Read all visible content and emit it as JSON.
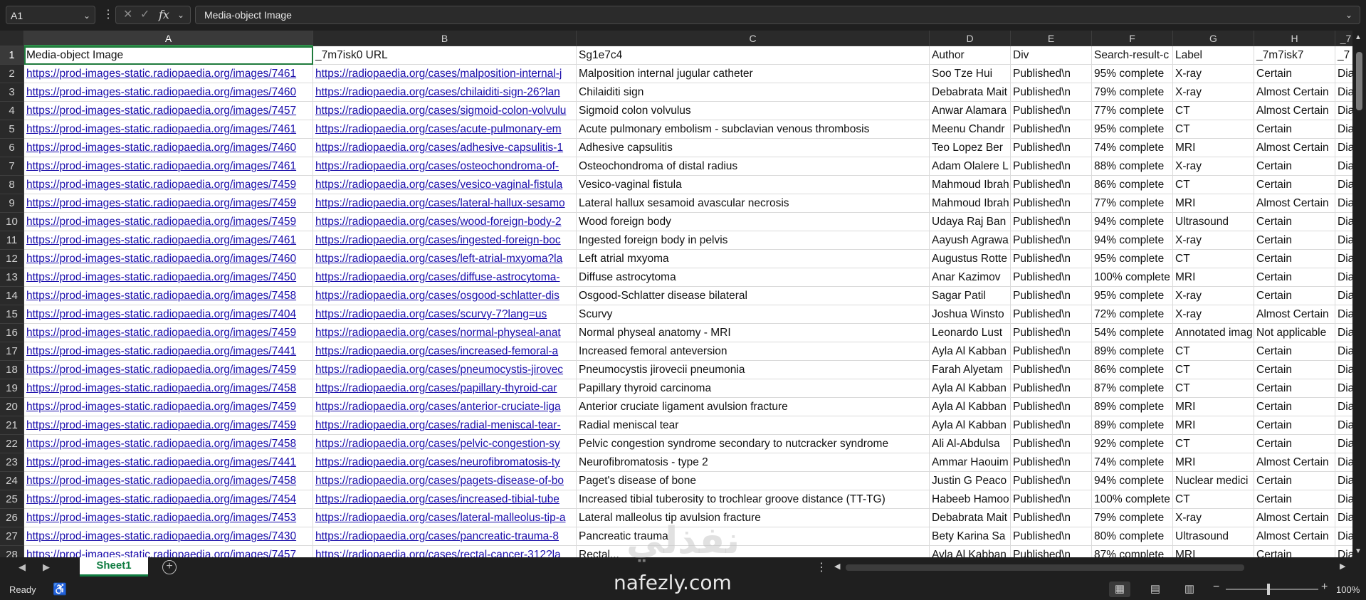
{
  "formula_bar": {
    "name_box": "A1",
    "fx_label": "fx",
    "formula_value": "Media-object Image"
  },
  "columns": [
    "A",
    "B",
    "C",
    "D",
    "E",
    "F",
    "G",
    "H",
    "I"
  ],
  "column_partial_label": "_7",
  "row_numbers": [
    "1",
    "2",
    "3",
    "4",
    "5",
    "6",
    "7",
    "8",
    "9",
    "10",
    "11",
    "12",
    "13",
    "14",
    "15",
    "16",
    "17",
    "18",
    "19",
    "20",
    "21",
    "22",
    "23",
    "24",
    "25",
    "26",
    "27",
    "28"
  ],
  "rows": [
    [
      "Media-object Image",
      "_7m7isk0 URL",
      "Sg1e7c4",
      "Author",
      "Div",
      "Search-result-c",
      "Label",
      "_7m7isk7",
      "_7"
    ],
    [
      "https://prod-images-static.radiopaedia.org/images/7461",
      "https://radiopaedia.org/cases/malposition-internal-j",
      "Malposition internal jugular catheter",
      "Soo Tze Hui",
      "Published\\n",
      "95% complete",
      "X-ray",
      "Certain",
      "Dia"
    ],
    [
      "https://prod-images-static.radiopaedia.org/images/7460",
      "https://radiopaedia.org/cases/chilaiditi-sign-26?lan",
      "Chilaiditi sign",
      "Debabrata Mait",
      "Published\\n",
      "79% complete",
      "X-ray",
      "Almost Certain",
      "Dia"
    ],
    [
      "https://prod-images-static.radiopaedia.org/images/7457",
      "https://radiopaedia.org/cases/sigmoid-colon-volvulu",
      "Sigmoid colon volvulus",
      "Anwar Alamara",
      "Published\\n",
      "77% complete",
      "CT",
      "Almost Certain",
      "Dia"
    ],
    [
      "https://prod-images-static.radiopaedia.org/images/7461",
      "https://radiopaedia.org/cases/acute-pulmonary-em",
      "Acute pulmonary embolism - subclavian venous thrombosis",
      "Meenu Chandr",
      "Published\\n",
      "95% complete",
      "CT",
      "Certain",
      "Dia"
    ],
    [
      "https://prod-images-static.radiopaedia.org/images/7460",
      "https://radiopaedia.org/cases/adhesive-capsulitis-1",
      "Adhesive capsulitis",
      "Teo Lopez Ber",
      "Published\\n",
      "74% complete",
      "MRI",
      "Almost Certain",
      "Dia"
    ],
    [
      "https://prod-images-static.radiopaedia.org/images/7461",
      "https://radiopaedia.org/cases/osteochondroma-of-",
      "Osteochondroma of distal radius",
      "Adam Olalere L",
      "Published\\n",
      "88% complete",
      "X-ray",
      "Certain",
      "Dia"
    ],
    [
      "https://prod-images-static.radiopaedia.org/images/7459",
      "https://radiopaedia.org/cases/vesico-vaginal-fistula",
      "Vesico-vaginal fistula",
      "Mahmoud Ibrah",
      "Published\\n",
      "86% complete",
      "CT",
      "Certain",
      "Dia"
    ],
    [
      "https://prod-images-static.radiopaedia.org/images/7459",
      "https://radiopaedia.org/cases/lateral-hallux-sesamo",
      "Lateral hallux sesamoid avascular necrosis",
      "Mahmoud Ibrah",
      "Published\\n",
      "77% complete",
      "MRI",
      "Almost Certain",
      "Dia"
    ],
    [
      "https://prod-images-static.radiopaedia.org/images/7459",
      "https://radiopaedia.org/cases/wood-foreign-body-2",
      "Wood foreign body",
      "Udaya Raj Ban",
      "Published\\n",
      "94% complete",
      "Ultrasound",
      "Certain",
      "Dia"
    ],
    [
      "https://prod-images-static.radiopaedia.org/images/7461",
      "https://radiopaedia.org/cases/ingested-foreign-boc",
      "Ingested foreign body in pelvis",
      "Aayush Agrawa",
      "Published\\n",
      "94% complete",
      "X-ray",
      "Certain",
      "Dia"
    ],
    [
      "https://prod-images-static.radiopaedia.org/images/7460",
      "https://radiopaedia.org/cases/left-atrial-mxyoma?la",
      "Left atrial mxyoma",
      "Augustus Rotte",
      "Published\\n",
      "95% complete",
      "CT",
      "Certain",
      "Dia"
    ],
    [
      "https://prod-images-static.radiopaedia.org/images/7450",
      "https://radiopaedia.org/cases/diffuse-astrocytoma-",
      "Diffuse astrocytoma",
      "Anar Kazimov",
      "Published\\n",
      "100% complete",
      "MRI",
      "Certain",
      "Dia"
    ],
    [
      "https://prod-images-static.radiopaedia.org/images/7458",
      "https://radiopaedia.org/cases/osgood-schlatter-dis",
      "Osgood-Schlatter disease bilateral",
      "Sagar Patil",
      "Published\\n",
      "95% complete",
      "X-ray",
      "Certain",
      "Dia"
    ],
    [
      "https://prod-images-static.radiopaedia.org/images/7404",
      "https://radiopaedia.org/cases/scurvy-7?lang=us",
      "Scurvy",
      "Joshua Winsto",
      "Published\\n",
      "72% complete",
      "X-ray",
      "Almost Certain",
      "Dia"
    ],
    [
      "https://prod-images-static.radiopaedia.org/images/7459",
      "https://radiopaedia.org/cases/normal-physeal-anat",
      "Normal physeal anatomy - MRI",
      "Leonardo Lust",
      "Published\\n",
      "54% complete",
      "Annotated imag",
      "Not applicable",
      "Dia"
    ],
    [
      "https://prod-images-static.radiopaedia.org/images/7441",
      "https://radiopaedia.org/cases/increased-femoral-a",
      "Increased femoral anteversion",
      "Ayla Al Kabban",
      "Published\\n",
      "89% complete",
      "CT",
      "Certain",
      "Dia"
    ],
    [
      "https://prod-images-static.radiopaedia.org/images/7459",
      "https://radiopaedia.org/cases/pneumocystis-jirovec",
      "Pneumocystis jirovecii pneumonia",
      "Farah Alyetam",
      "Published\\n",
      "86% complete",
      "CT",
      "Certain",
      "Dia"
    ],
    [
      "https://prod-images-static.radiopaedia.org/images/7458",
      "https://radiopaedia.org/cases/papillary-thyroid-car",
      "Papillary thyroid carcinoma",
      "Ayla Al Kabban",
      "Published\\n",
      "87% complete",
      "CT",
      "Certain",
      "Dia"
    ],
    [
      "https://prod-images-static.radiopaedia.org/images/7459",
      "https://radiopaedia.org/cases/anterior-cruciate-liga",
      "Anterior cruciate ligament avulsion fracture",
      "Ayla Al Kabban",
      "Published\\n",
      "89% complete",
      "MRI",
      "Certain",
      "Dia"
    ],
    [
      "https://prod-images-static.radiopaedia.org/images/7459",
      "https://radiopaedia.org/cases/radial-meniscal-tear-",
      "Radial meniscal tear",
      "Ayla Al Kabban",
      "Published\\n",
      "89% complete",
      "MRI",
      "Certain",
      "Dia"
    ],
    [
      "https://prod-images-static.radiopaedia.org/images/7458",
      "https://radiopaedia.org/cases/pelvic-congestion-sy",
      "Pelvic congestion syndrome secondary to nutcracker syndrome",
      "Ali Al-Abdulsa",
      "Published\\n",
      "92% complete",
      "CT",
      "Certain",
      "Dia"
    ],
    [
      "https://prod-images-static.radiopaedia.org/images/7441",
      "https://radiopaedia.org/cases/neurofibromatosis-ty",
      "Neurofibromatosis - type 2",
      "Ammar Haouim",
      "Published\\n",
      "74% complete",
      "MRI",
      "Almost Certain",
      "Dia"
    ],
    [
      "https://prod-images-static.radiopaedia.org/images/7458",
      "https://radiopaedia.org/cases/pagets-disease-of-bo",
      "Paget's disease of bone",
      "Justin G Peaco",
      "Published\\n",
      "94% complete",
      "Nuclear medici",
      "Certain",
      "Dia"
    ],
    [
      "https://prod-images-static.radiopaedia.org/images/7454",
      "https://radiopaedia.org/cases/increased-tibial-tube",
      "Increased tibial tuberosity to trochlear groove distance (TT-TG)",
      "Habeeb Hamoo",
      "Published\\n",
      "100% complete",
      "CT",
      "Certain",
      "Dia"
    ],
    [
      "https://prod-images-static.radiopaedia.org/images/7453",
      "https://radiopaedia.org/cases/lateral-malleolus-tip-a",
      "Lateral malleolus tip avulsion fracture",
      "Debabrata Mait",
      "Published\\n",
      "79% complete",
      "X-ray",
      "Almost Certain",
      "Dia"
    ],
    [
      "https://prod-images-static.radiopaedia.org/images/7430",
      "https://radiopaedia.org/cases/pancreatic-trauma-8",
      "Pancreatic trauma",
      "Bety Karina Sa",
      "Published\\n",
      "80% complete",
      "Ultrasound",
      "Almost Certain",
      "Dia"
    ],
    [
      "https://prod-images-static.radiopaedia.org/images/7457",
      "https://radiopaedia.org/cases/rectal-cancer-312?la",
      "Rectal...",
      "Ayla Al Kabban",
      "Published\\n",
      "87% complete",
      "MRI",
      "Certain",
      "Dia"
    ]
  ],
  "sheet_tab": "Sheet1",
  "status": {
    "ready": "Ready",
    "zoom": "100%"
  },
  "watermark": {
    "arabic": "نفذلي",
    "domain": "nafezly.com"
  },
  "colors": {
    "accent": "#107c41",
    "link": "#1a0dab",
    "chrome": "#1f1f1f"
  }
}
